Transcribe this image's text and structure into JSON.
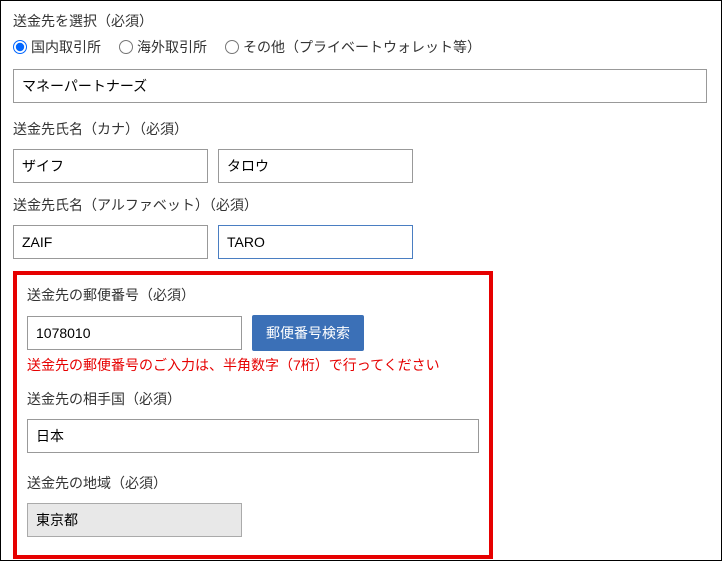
{
  "destination": {
    "label": "送金先を選択（必須）",
    "options": {
      "domestic": "国内取引所",
      "overseas": "海外取引所",
      "other": "その他（プライベートウォレット等）"
    },
    "selected": "domestic",
    "exchange_name": "マネーパートナーズ"
  },
  "name_kana": {
    "label": "送金先氏名（カナ）（必須）",
    "last": "ザイフ",
    "first": "タロウ"
  },
  "name_alpha": {
    "label": "送金先氏名（アルファベット）（必須）",
    "last": "ZAIF",
    "first": "TARO"
  },
  "postal": {
    "label": "送金先の郵便番号（必須）",
    "value": "1078010",
    "search_button": "郵便番号検索",
    "error": "送金先の郵便番号のご入力は、半角数字（7桁）で行ってください"
  },
  "country": {
    "label": "送金先の相手国（必須）",
    "value": "日本"
  },
  "region": {
    "label": "送金先の地域（必須）",
    "value": "東京都"
  }
}
